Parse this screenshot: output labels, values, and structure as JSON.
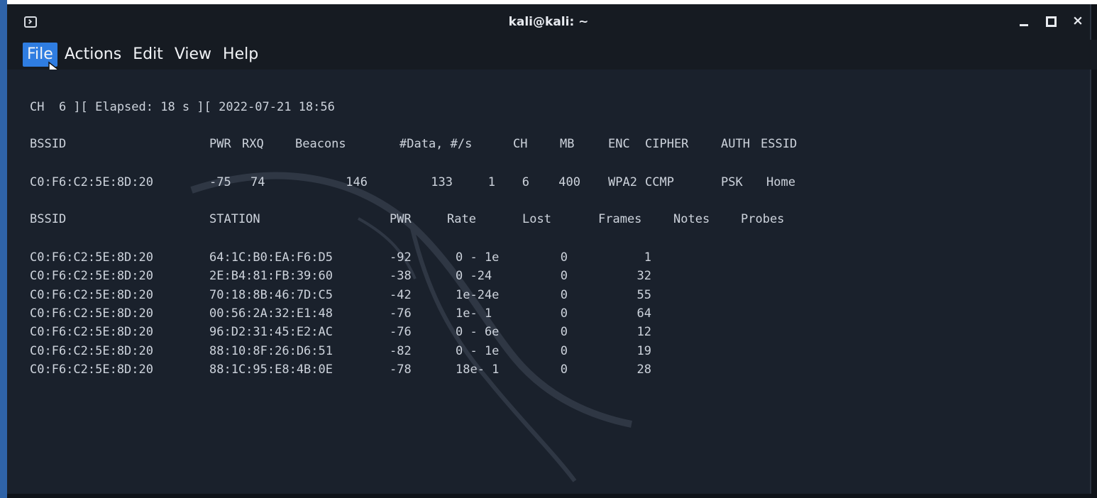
{
  "window": {
    "title": "kali@kali: ~",
    "controls": {
      "minimize": "_",
      "maximize": "□",
      "close": "×"
    }
  },
  "menu": [
    "File",
    "Actions",
    "Edit",
    "View",
    "Help"
  ],
  "terminal": {
    "status_line": "CH  6 ][ Elapsed: 18 s ][ 2022-07-21 18:56",
    "ap_headers": [
      "BSSID",
      "PWR",
      "RXQ",
      "Beacons",
      "#Data, #/s",
      "CH",
      "MB",
      "ENC",
      "CIPHER",
      "AUTH",
      "ESSID"
    ],
    "ap_rows": [
      {
        "bssid": "C0:F6:C2:5E:8D:20",
        "pwr": "-75",
        "rxq": "74",
        "beacons": "146",
        "data": "133",
        "per_s": "1",
        "ch": "6",
        "mb": "400",
        "enc": "WPA2",
        "cipher": "CCMP",
        "auth": "PSK",
        "essid": "Home"
      }
    ],
    "station_headers": [
      "BSSID",
      "STATION",
      "PWR",
      "Rate",
      "Lost",
      "Frames",
      "Notes",
      "Probes"
    ],
    "station_rows": [
      {
        "bssid": "C0:F6:C2:5E:8D:20",
        "station": "64:1C:B0:EA:F6:D5",
        "pwr": "-92",
        "rate": "0 - 1e",
        "lost": "0",
        "frames": "1"
      },
      {
        "bssid": "C0:F6:C2:5E:8D:20",
        "station": "2E:B4:81:FB:39:60",
        "pwr": "-38",
        "rate": "0 -24",
        "lost": "0",
        "frames": "32"
      },
      {
        "bssid": "C0:F6:C2:5E:8D:20",
        "station": "70:18:8B:46:7D:C5",
        "pwr": "-42",
        "rate": "1e-24e",
        "lost": "0",
        "frames": "55"
      },
      {
        "bssid": "C0:F6:C2:5E:8D:20",
        "station": "00:56:2A:32:E1:48",
        "pwr": "-76",
        "rate": "1e- 1",
        "lost": "0",
        "frames": "64"
      },
      {
        "bssid": "C0:F6:C2:5E:8D:20",
        "station": "96:D2:31:45:E2:AC",
        "pwr": "-76",
        "rate": "0 - 6e",
        "lost": "0",
        "frames": "12"
      },
      {
        "bssid": "C0:F6:C2:5E:8D:20",
        "station": "88:10:8F:26:D6:51",
        "pwr": "-82",
        "rate": "0 - 1e",
        "lost": "0",
        "frames": "19"
      },
      {
        "bssid": "C0:F6:C2:5E:8D:20",
        "station": "88:1C:95:E8:4B:0E",
        "pwr": "-78",
        "rate": "18e- 1",
        "lost": "0",
        "frames": "28"
      }
    ]
  }
}
